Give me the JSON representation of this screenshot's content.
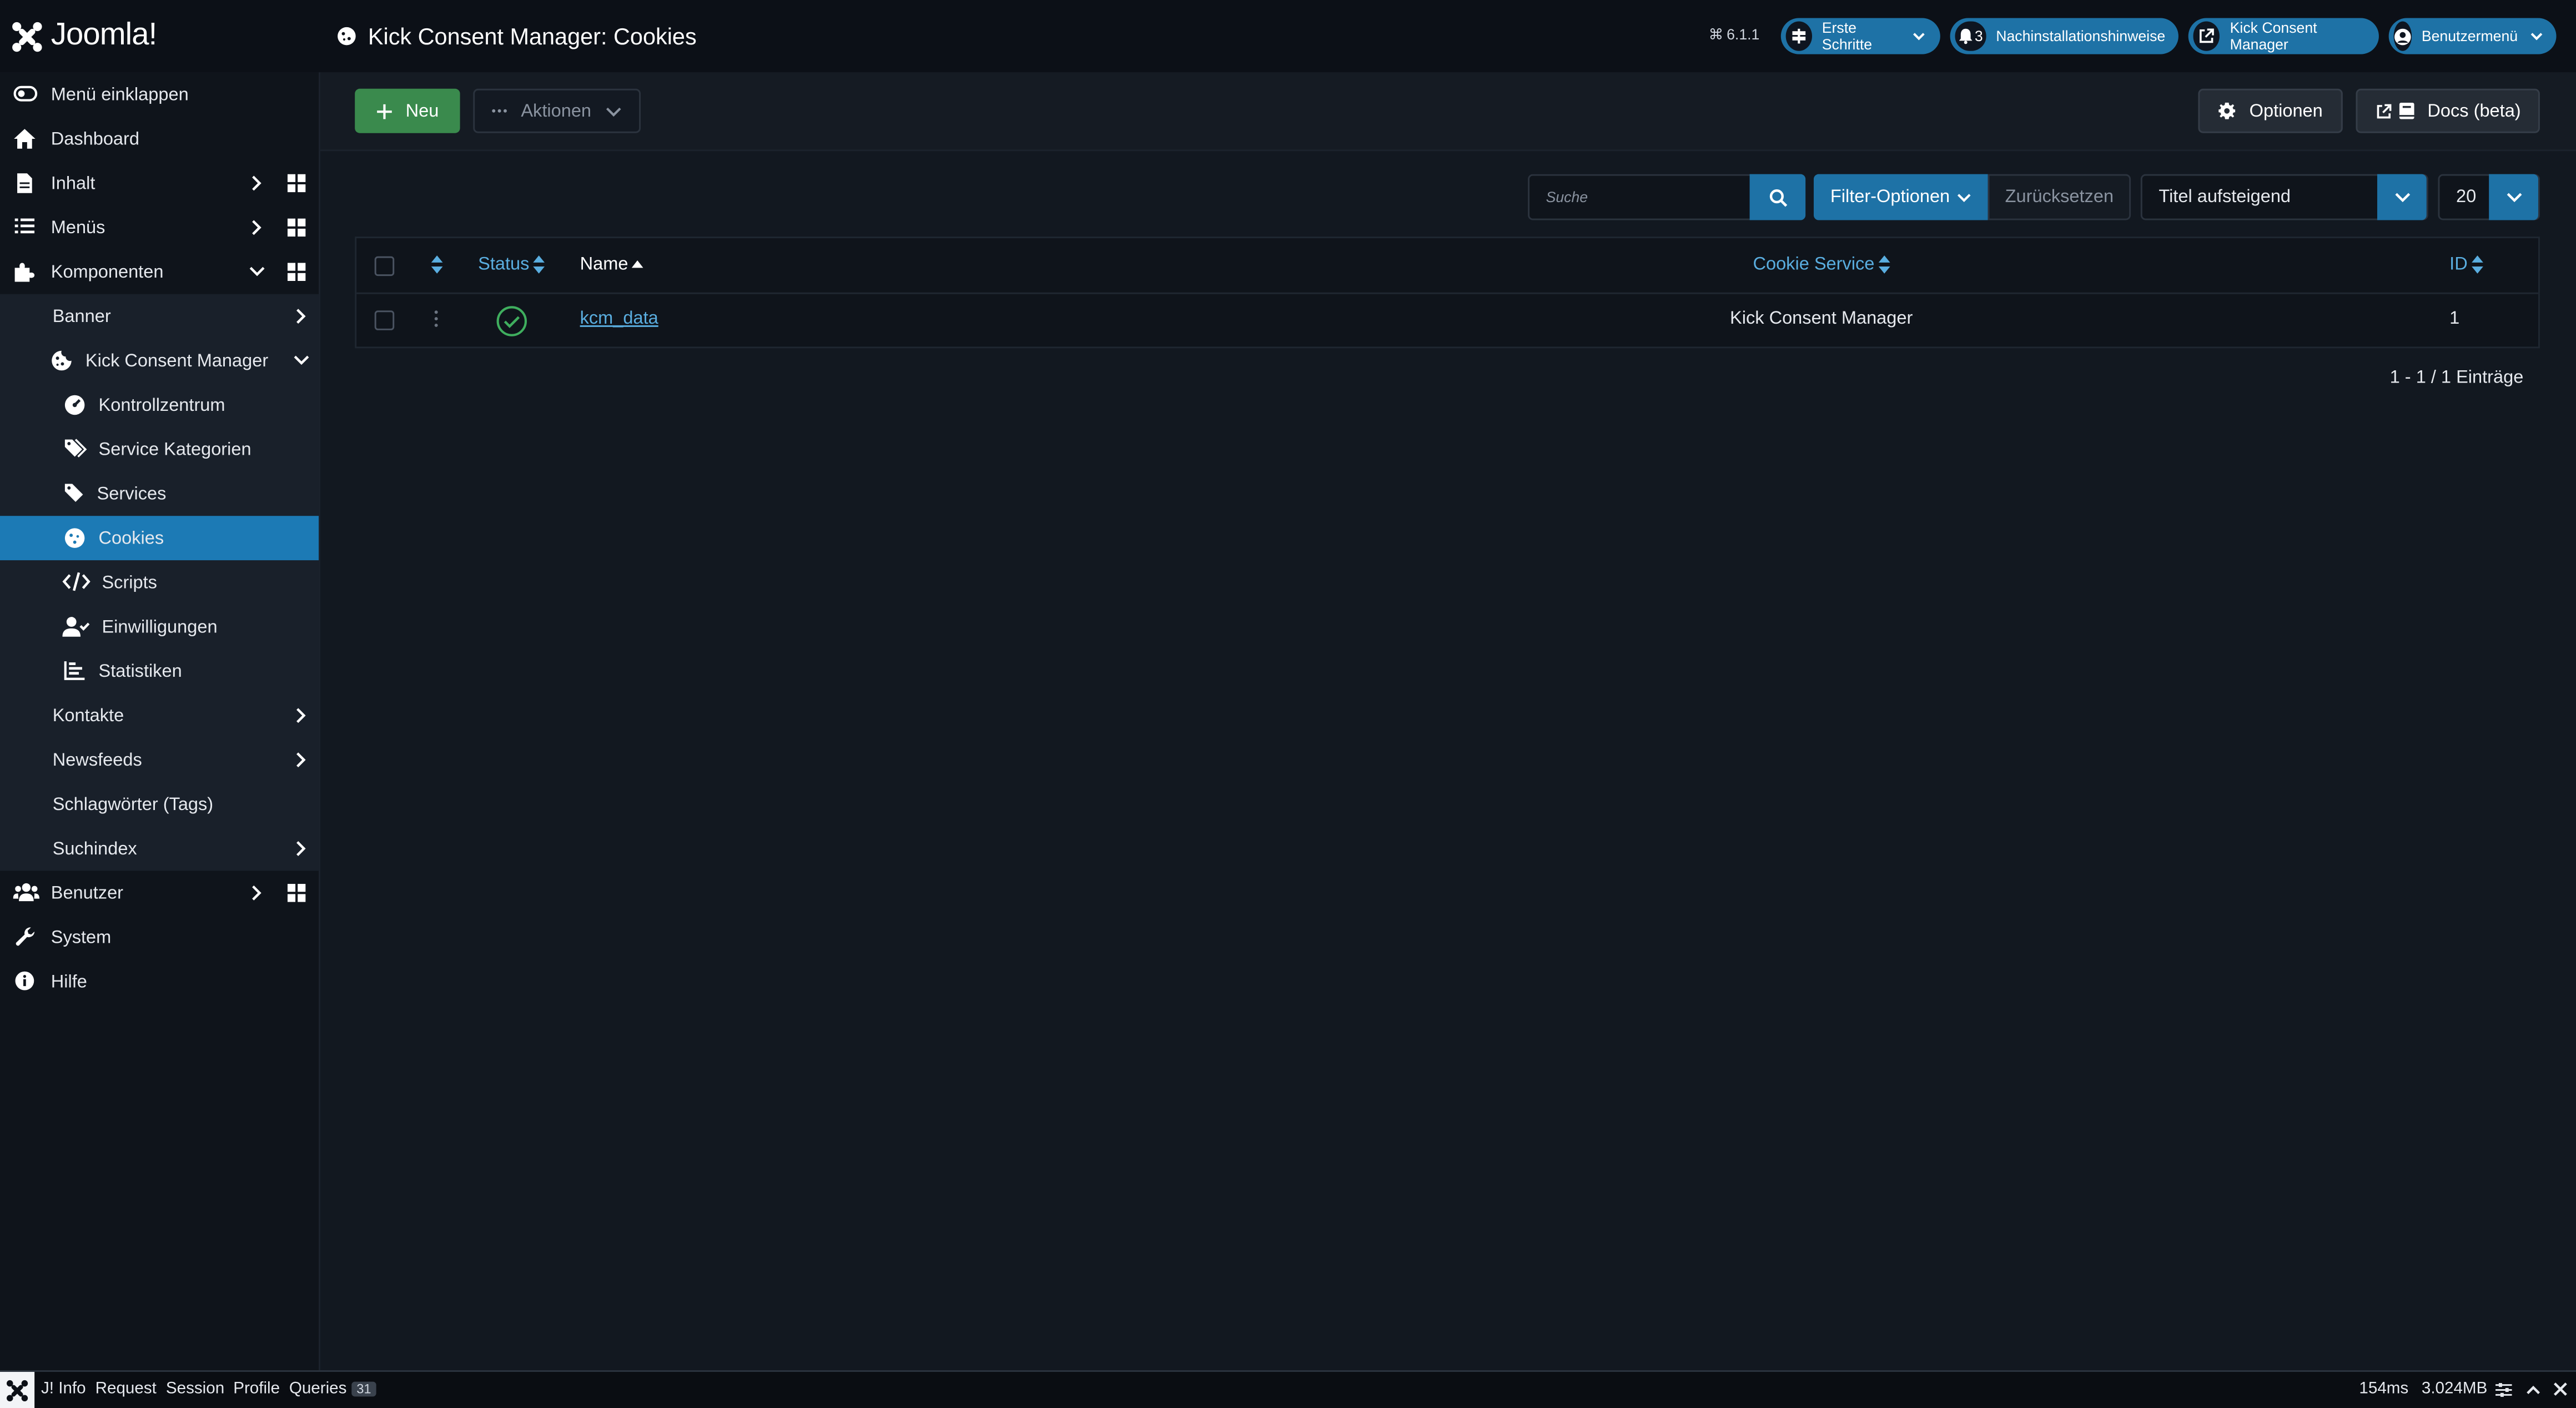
{
  "header": {
    "logo_text": "Joomla!",
    "page_title": "Kick Consent Manager: Cookies",
    "version": "6.1.1",
    "buttons": [
      {
        "label": "Erste Schritte"
      },
      {
        "label": "Nachinstallationshinweise",
        "count": "3"
      },
      {
        "label": "Kick Consent Manager"
      },
      {
        "label": "Benutzermenü"
      }
    ]
  },
  "sidebar": {
    "collapse": "Menü einklappen",
    "dashboard": "Dashboard",
    "content": "Inhalt",
    "menus": "Menüs",
    "components": "Komponenten",
    "banner": "Banner",
    "kcm": "Kick Consent Manager",
    "kcm_items": [
      "Kontrollzentrum",
      "Service Kategorien",
      "Services",
      "Cookies",
      "Scripts",
      "Einwilligungen",
      "Statistiken"
    ],
    "contacts": "Kontakte",
    "newsfeeds": "Newsfeeds",
    "tags": "Schlagwörter (Tags)",
    "search_index": "Suchindex",
    "users": "Benutzer",
    "system": "System",
    "help": "Hilfe"
  },
  "toolbar": {
    "new": "Neu",
    "actions": "Aktionen",
    "options": "Optionen",
    "docs": "Docs (beta)"
  },
  "filters": {
    "search_placeholder": "Suche",
    "filter_options": "Filter-Optionen",
    "reset": "Zurücksetzen",
    "ordering": "Titel aufsteigend",
    "limit": "20"
  },
  "table": {
    "columns": {
      "status": "Status",
      "name": "Name",
      "cookie_service": "Cookie Service",
      "id": "ID"
    },
    "rows": [
      {
        "name": "kcm_data",
        "cookie_service": "Kick Consent Manager",
        "id": "1",
        "status": "published"
      }
    ],
    "count": "1 - 1 / 1 Einträge"
  },
  "debug": {
    "items": [
      "J! Info",
      "Request",
      "Session",
      "Profile",
      "Queries"
    ],
    "queries_count": "31",
    "time": "154ms",
    "memory": "3.024MB"
  },
  "colors": {
    "accent": "#1e72a6",
    "active": "#1c7ab5",
    "success": "#3a8a4d",
    "link": "#5aaee0"
  }
}
